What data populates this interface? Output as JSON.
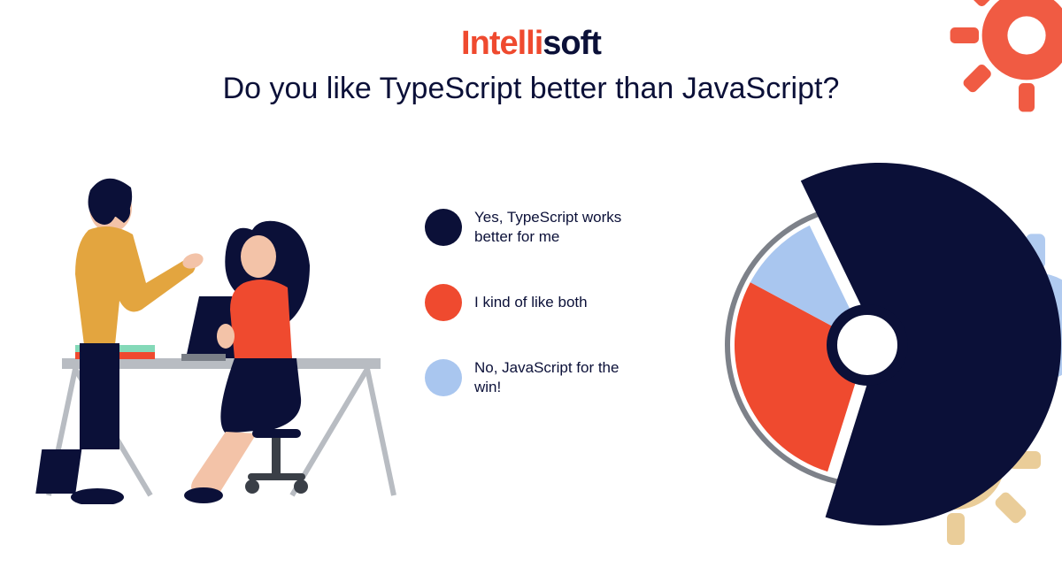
{
  "brand": {
    "accent": "Intelli",
    "rest": "soft"
  },
  "title": "Do you like TypeScript better than JavaScript?",
  "legend": [
    {
      "label": "Yes, TypeScript works better for me",
      "color": "#0b1038"
    },
    {
      "label": "I kind of like both",
      "color": "#ef4a2f"
    },
    {
      "label": "No, JavaScript for the win!",
      "color": "#a9c6ef"
    }
  ],
  "chart_data": {
    "type": "pie",
    "title": "Do you like TypeScript better than JavaScript?",
    "series": [
      {
        "name": "Yes, TypeScript works better for me",
        "value": 62,
        "color": "#0b1038"
      },
      {
        "name": "I kind of like both",
        "value": 28,
        "color": "#ef4a2f"
      },
      {
        "name": "No, JavaScript for the win!",
        "value": 10,
        "color": "#a9c6ef"
      }
    ]
  },
  "colors": {
    "gear_red": "#ef4a2f",
    "gear_blue": "#a9c6ef",
    "gear_tan": "#e8c88f"
  }
}
